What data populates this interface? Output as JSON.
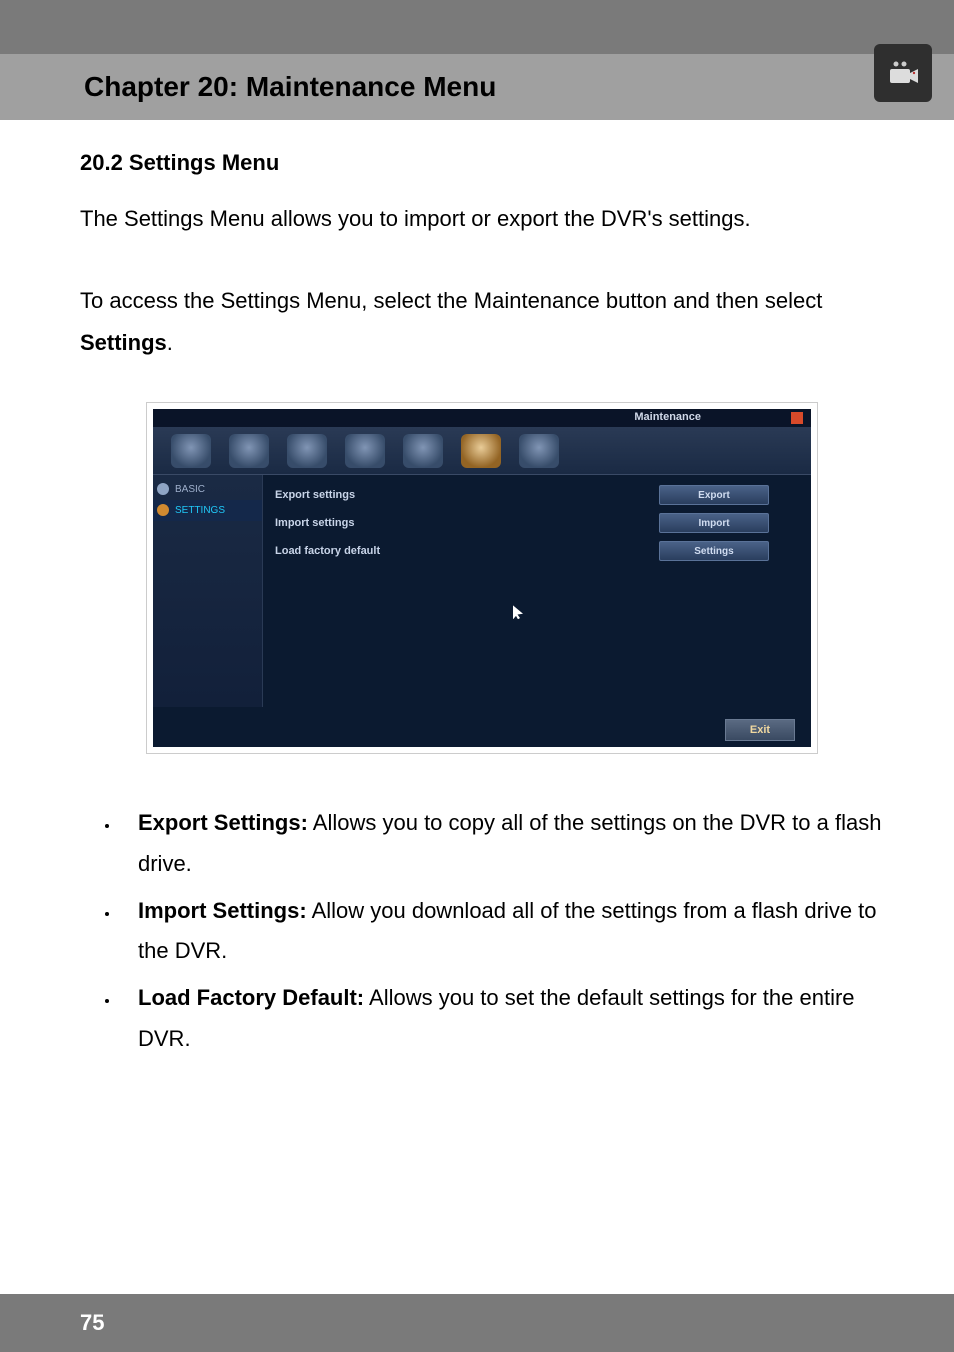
{
  "header": {
    "chapter_title": "Chapter 20: Maintenance Menu"
  },
  "section": {
    "heading": "20.2 Settings Menu",
    "para1": "The Settings Menu allows you to import or export the DVR's settings.",
    "para2_pre": "To access the Settings Menu, select the Maintenance button and then select ",
    "para2_bold": "Settings",
    "para2_post": "."
  },
  "screenshot": {
    "window_title": "Maintenance",
    "sidebar": {
      "items": [
        {
          "label": "BASIC"
        },
        {
          "label": "SETTINGS"
        }
      ]
    },
    "rows": [
      {
        "label": "Export settings",
        "button": "Export"
      },
      {
        "label": "Import settings",
        "button": "Import"
      },
      {
        "label": "Load factory default",
        "button": "Settings"
      }
    ],
    "exit_label": "Exit"
  },
  "bullets": [
    {
      "term": "Export Settings:",
      "desc": " Allows you to copy all of the settings on the DVR to a flash drive."
    },
    {
      "term": "Import Settings:",
      "desc": " Allow you download all of the settings from a flash drive to the DVR."
    },
    {
      "term": "Load Factory Default:",
      "desc": " Allows you to set the default settings for the entire DVR."
    }
  ],
  "page_number": "75"
}
